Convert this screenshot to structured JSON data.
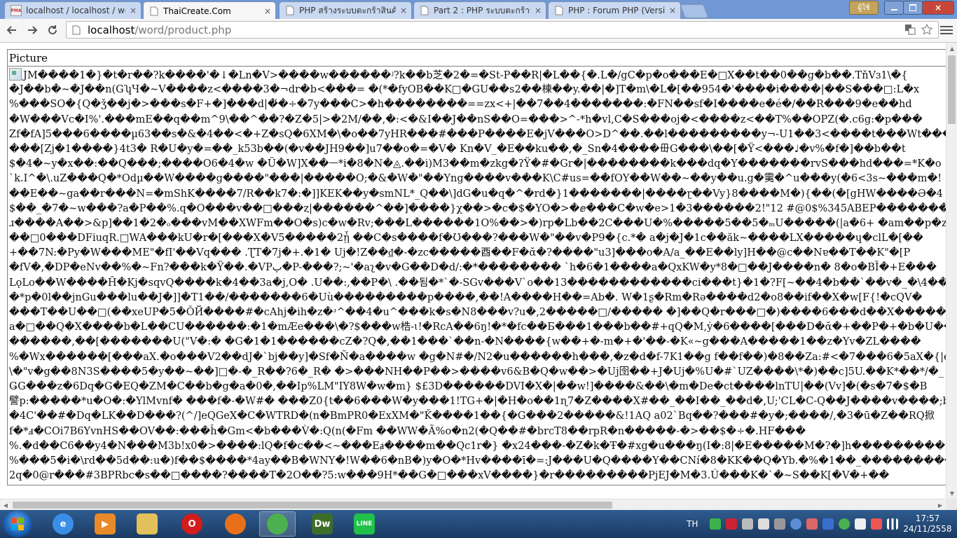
{
  "browser": {
    "tabs": [
      {
        "title": "localhost / localhost / wor",
        "favicon": "phpmyadmin-icon",
        "favicon_text": "PMA",
        "active": false
      },
      {
        "title": "ThaiCreate.Com",
        "favicon": "page-icon",
        "active": true
      },
      {
        "title": "PHP สร้างระบบตะกร้าสินค้า",
        "favicon": "page-icon",
        "active": false
      },
      {
        "title": "Part 2 : PHP ระบบตะกร้าสินค",
        "favicon": "page-icon",
        "active": false
      },
      {
        "title": "PHP : Forum PHP (Version",
        "favicon": "page-icon",
        "active": false
      }
    ],
    "close_glyph": "×",
    "profile_label": "ผู้ใช้",
    "url_host": "localhost",
    "url_path": "/word/product.php"
  },
  "page": {
    "table_header": "Picture",
    "garbled_lines": [
      "JM����1�}�t�r��?k����'�↓�Ln�V>����w������ʲ?k��b芝�2�=�St-P��R|�L��{�.L�/gC�p�o���E�□X��t��0��g�b��.TňVɜ1\\�{",
      "�J��b�~�J��n(GʮЧ�~V����z<����3�¬dr�b<���= �(*�fyOB��K□�GU��s2��棟��y.��|�]T�m\\�L�[��954�'����i����|��S���□:L�x",
      "%���SO�{Q�ǯ��j�>���s�F+�]���d|�́�÷�7y���C>�h��������==zx<+|��7��4�������:�FN��sf�I����e�é�/��R���9�e��hd",
      "�W���Vc�I%'.���mE��q��m^9\\��^��?�Z�5|>�2M/��,�:<�&I��J��nS��O=���>^-*h�vl,C�S���oj�<����z<��T%��OPZ(�.c6g:�p���",
      "Zf�fA]5���6����µ63��s�&�4��<�+Z�sQ�6XM�\\�o��7yHR���#���P����E�jV���O>D^��.��l���������y¬-U1��3<����t���Wt���D",
      "���[Zj�1����}4t3� R�U�y�=��_k53b��(�v��JH9��]u7��o�=�V� Kn�V_�E��ku��,�_Sn�4����毌G���\\��[�Ÿ<���♩�v%�f�]��b��t",
      "$�4�~y�x��:��Q���;����O6�4�w �Ü�W]X��ᅳ*i�8�N�◬.��i)M3��m�zkg�ʔŸ�#�Gr�|��������k���dq�Y�������rvS���hd���=*K�o",
      "`k.I^�\\.uZ���Q�*Odµ��W����g����\"���|�����O;�&�W�\"��Yng����v���K\\C#us=��fOY��W��~��y��u.g�䨑�^u���y(�6<3s~���m�!",
      "��E��~ga��r���N=�mShK����7/R��k7�:�]]KEK��y�smNL*_Q��\\]dG�u�q�^�rd�}1�������|����ɽ��Vy}8����M�){��(�[gHW����Ə�4",
      "$��_�7�~w���?a�P��%.q�O���v��□���ⱬ|������^��]����}χ��>�c�$�YO�>�ⅇ���C�w�e>1�3������2!\"12 #@0$%345ABEP��������",
      "ɹ����A��>&p]��1�2�ₒ���vM��XWFm��O�s)c�w�Rv;���L������1O%��>�)rp�Lb��2C���U�%�����5��5�ₘU�����(|a�6+ �am��p�z�",
      "��□0���DFiuqR.□WA���kU�r�[���X�V5�����2ᾗ ��C�s����f�Ʊ���?���W�\"��v�P9�{c.*� a�j�J�1c��ăk~����LX�����ɥ�clL�[��",
      "+��7N:�Py�W���ME\"�fI'��Vq��� .ƮT�7j�+.�1� Uj�!Z��₫�-�zc�����酉��F�ᾰ�?����\"u3]���o�A/a_��E��ly]H��@c��Nɐ��T��K\"�[P",
      "�fV�,�DP�eNv��%�~Fn?���k�Ÿ��.�VPپ�P-���?;~'�aʅ�v�G��D�d/:�*�������� `h�6�1����a�QxKW�y*8�□��J����n� 8�o�BȈ�+E���",
      "LǫLo��W����Ĥ�Kj�sqvQ����k�4��3a�j,O� .U��:,��P�\\ .��됨�*`�-SGv���V`o��13������������ci���t}�1�?F[~��4�b��`��v�_�\\4�����V",
      "�*p�0l��jnGu���lu��J�]]�T1��/�������6�Uù���������p����,��!A����H��=Ab�. W�1ʂ�Rm�Rə����d2�o8��if��X�w[F{!�cQV�",
      "���T��U��□(��xeUP�5�ǑЙ����#�cAhj�ih�z�ʴ^��4�u^���k�s�N8���v?u�,2�����□/����� �]��Q�r���□�)����6���d��X������y",
      "a�□��Q�X����b�L��CU������:�1�mÆe���\\�?$���w梏-ɩ!�RcA��6ŋ!�*�fc��Б���1���b��#+qQ�M,ẏ�6����[���D�ᾰ�+��P�+�b�U��",
      "������,��[�������U(\"V�:� �G�1�1������cZ�?Q�,��1���`��n-�N����{w��+�-m�+�'��-�K«~g���A�����1��z�Yv�ZL����",
      "%�Wx������[���aX.�o���V2��dJ�`bj��y]�Sf�Ñ�a����w �g�N#�/N2�u������h���,�z�d�f-7K1��g f��f��)�8��Za:#<�7���6�5aX�{|e5",
      "\\�\"v�g��8N3S����5�y��~��]□�-�_R��?6�_R� �>���NH��P��>����v6&B�Q�w��>�Uj囹��+J�Uj�%U�#`UZ����\\*�)��c]5U.��K*��*/�_",
      "ǤG���z�6Dq�G�EQ�ZM�C��b�g�a�0�,��Ip%LM\"IY8W�w�m} $£3D������DVI�X�|��w!]����&��\\�m�De�ct����lnTU|��(Vv]�(�s�7�$�B",
      "譬p:�����*u�O�:�YlMvnf� ���f�-�W#� ���Z0{t��6���W�y���1!TG+�|�H�o��1ɳ7�Z����X#��_��I��_��d�,U;'CL�C-Q��J����v����;bER��",
      "�4C'��#�Dq�LK��D���?(^/]eQGeX�C�WTRD�(n�BmPR0�ExXM�\"Ǩ����1��{�G���2�����&!1AQ a02`Bq��?���#�y�;����/,�3�ū�Z��RQ掀",
      "f�*ⅎ�COi7B6YvnHS��OV��:���ȟ�Gm<�b���V̀�:Q(n(�Fm ��WW�Ã%o�n2(�Q��#�brcT8��rpR�n�����-�>��$�÷�.HF���",
      "%.�d��C6��y4�N���M3b!x0�>����:lQ�f�c��<~���Eⱥ����m��Qc1r�} �x24���-�Z�k�Ŧ�#xg�u���ŋ(I�:8|�E�����M�?�]h���������r���",
      "%���5�i�\\rd��5d��:u�)f��$����*4ay��B�WNY�!W��6�nB�)y�O�*Hv����ī�=:J���U�Q����Y��CNí�8�KK��Q�Yb.�%�1��_���������",
      "2q�0@r���#3BPRbc�s��□����?����T�2O��?5:w���9H*��G�□���xV����}�r���������PjEJ�M�3.Ú���K�`�~S��K[�V�+��"
    ]
  },
  "taskbar": {
    "apps": [
      {
        "name": "internet-explorer-icon",
        "label": "e",
        "color": "#3a8ee6"
      },
      {
        "name": "media-player-icon",
        "label": "▶",
        "color": "#e98a2a"
      },
      {
        "name": "file-explorer-icon",
        "label": "",
        "color": "#e3c15a"
      },
      {
        "name": "opera-icon",
        "label": "O",
        "color": "#d41c1c"
      },
      {
        "name": "firefox-icon",
        "label": "",
        "color": "#e8701a"
      },
      {
        "name": "chrome-icon",
        "label": "",
        "color": "#4caf50"
      },
      {
        "name": "dreamweaver-icon",
        "label": "Dw",
        "color": "#3c6e2a"
      },
      {
        "name": "line-icon",
        "label": "LINE",
        "color": "#20c04a"
      }
    ],
    "language": "TH",
    "clock_time": "17:57",
    "clock_date": "24/11/2558"
  }
}
